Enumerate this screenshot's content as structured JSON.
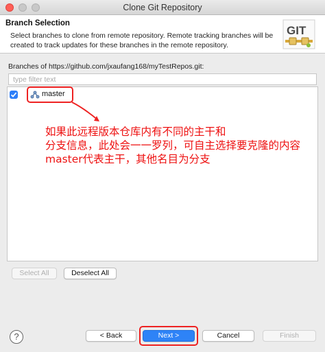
{
  "window": {
    "title": "Clone Git Repository"
  },
  "header": {
    "title": "Branch Selection",
    "description": "Select branches to clone from remote repository. Remote tracking branches will be created to track updates for these branches in the remote repository.",
    "logo_text": "GIT"
  },
  "branches": {
    "label": "Branches of https://github.com/jxaufang168/myTestRepos.git:",
    "filter_placeholder": "type filter text",
    "filter_value": "",
    "items": [
      {
        "name": "master",
        "checked": true
      }
    ]
  },
  "annotation": {
    "text": "如果此远程版本仓库内有不同的主干和\n分支信息，此处会一一罗列，可自主选择要克隆的内容\nmaster代表主干，其他名目为分支",
    "color": "#ee1111"
  },
  "selection_buttons": {
    "select_all": "Select All",
    "deselect_all": "Deselect All"
  },
  "footer": {
    "help": "?",
    "back": "< Back",
    "next": "Next >",
    "cancel": "Cancel",
    "finish": "Finish"
  },
  "colors": {
    "accent": "#2e83f7",
    "highlight": "#ee2222"
  }
}
